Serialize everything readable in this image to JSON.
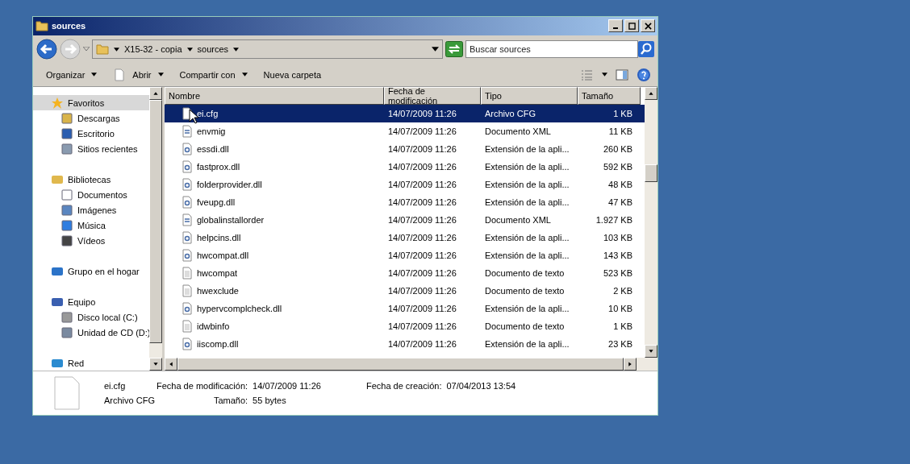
{
  "window": {
    "title": "sources"
  },
  "address": {
    "crumbs": [
      "X15-32 - copia",
      "sources"
    ],
    "search_placeholder": "Buscar sources"
  },
  "toolbar": [
    {
      "label": "Organizar",
      "dropdown": true,
      "icon": false
    },
    {
      "label": "Abrir",
      "dropdown": true,
      "icon": true
    },
    {
      "label": "Compartir con",
      "dropdown": true,
      "icon": false
    },
    {
      "label": "Nueva carpeta",
      "dropdown": false,
      "icon": false
    }
  ],
  "sidebar": {
    "groups": [
      {
        "label": "Favoritos",
        "kind": "star",
        "selected": true,
        "children": [
          {
            "label": "Descargas",
            "kind": "download"
          },
          {
            "label": "Escritorio",
            "kind": "desktop"
          },
          {
            "label": "Sitios recientes",
            "kind": "recent"
          }
        ]
      },
      {
        "label": "Bibliotecas",
        "kind": "library",
        "selected": false,
        "children": [
          {
            "label": "Documentos",
            "kind": "doc"
          },
          {
            "label": "Imágenes",
            "kind": "image"
          },
          {
            "label": "Música",
            "kind": "music"
          },
          {
            "label": "Vídeos",
            "kind": "video"
          }
        ]
      },
      {
        "label": "Grupo en el hogar",
        "kind": "homegroup",
        "selected": false
      },
      {
        "label": "Equipo",
        "kind": "computer",
        "selected": false,
        "children": [
          {
            "label": "Disco local (C:)",
            "kind": "disk"
          },
          {
            "label": "Unidad de CD (D:)",
            "kind": "cd"
          }
        ]
      },
      {
        "label": "Red",
        "kind": "network",
        "selected": false
      }
    ]
  },
  "table": {
    "columns": [
      "Nombre",
      "Fecha de modificación",
      "Tipo",
      "Tamaño"
    ],
    "rows": [
      {
        "kind": "blank",
        "name": "ei.cfg",
        "date": "14/07/2009 11:26",
        "type": "Archivo CFG",
        "size": "1 KB",
        "selected": true
      },
      {
        "kind": "xml",
        "name": "envmig",
        "date": "14/07/2009 11:26",
        "type": "Documento XML",
        "size": "11 KB",
        "selected": false
      },
      {
        "kind": "dll",
        "name": "essdi.dll",
        "date": "14/07/2009 11:26",
        "type": "Extensión de la apli...",
        "size": "260 KB",
        "selected": false
      },
      {
        "kind": "dll",
        "name": "fastprox.dll",
        "date": "14/07/2009 11:26",
        "type": "Extensión de la apli...",
        "size": "592 KB",
        "selected": false
      },
      {
        "kind": "dll",
        "name": "folderprovider.dll",
        "date": "14/07/2009 11:26",
        "type": "Extensión de la apli...",
        "size": "48 KB",
        "selected": false
      },
      {
        "kind": "dll",
        "name": "fveupg.dll",
        "date": "14/07/2009 11:26",
        "type": "Extensión de la apli...",
        "size": "47 KB",
        "selected": false
      },
      {
        "kind": "xml",
        "name": "globalinstallorder",
        "date": "14/07/2009 11:26",
        "type": "Documento XML",
        "size": "1.927 KB",
        "selected": false
      },
      {
        "kind": "dll",
        "name": "helpcins.dll",
        "date": "14/07/2009 11:26",
        "type": "Extensión de la apli...",
        "size": "103 KB",
        "selected": false
      },
      {
        "kind": "dll",
        "name": "hwcompat.dll",
        "date": "14/07/2009 11:26",
        "type": "Extensión de la apli...",
        "size": "143 KB",
        "selected": false
      },
      {
        "kind": "text",
        "name": "hwcompat",
        "date": "14/07/2009 11:26",
        "type": "Documento de texto",
        "size": "523 KB",
        "selected": false
      },
      {
        "kind": "text",
        "name": "hwexclude",
        "date": "14/07/2009 11:26",
        "type": "Documento de texto",
        "size": "2 KB",
        "selected": false
      },
      {
        "kind": "dll",
        "name": "hypervcomplcheck.dll",
        "date": "14/07/2009 11:26",
        "type": "Extensión de la apli...",
        "size": "10 KB",
        "selected": false
      },
      {
        "kind": "text",
        "name": "idwbinfo",
        "date": "14/07/2009 11:26",
        "type": "Documento de texto",
        "size": "1 KB",
        "selected": false
      },
      {
        "kind": "dll",
        "name": "iiscomp.dll",
        "date": "14/07/2009 11:26",
        "type": "Extensión de la apli...",
        "size": "23 KB",
        "selected": false
      }
    ]
  },
  "details": {
    "name": "ei.cfg",
    "type": "Archivo CFG",
    "fields": [
      {
        "label": "Fecha de modificación:",
        "value": "14/07/2009 11:26"
      },
      {
        "label": "Tamaño:",
        "value": "55 bytes"
      },
      {
        "label": "Fecha de creación:",
        "value": "07/04/2013 13:54"
      }
    ]
  }
}
